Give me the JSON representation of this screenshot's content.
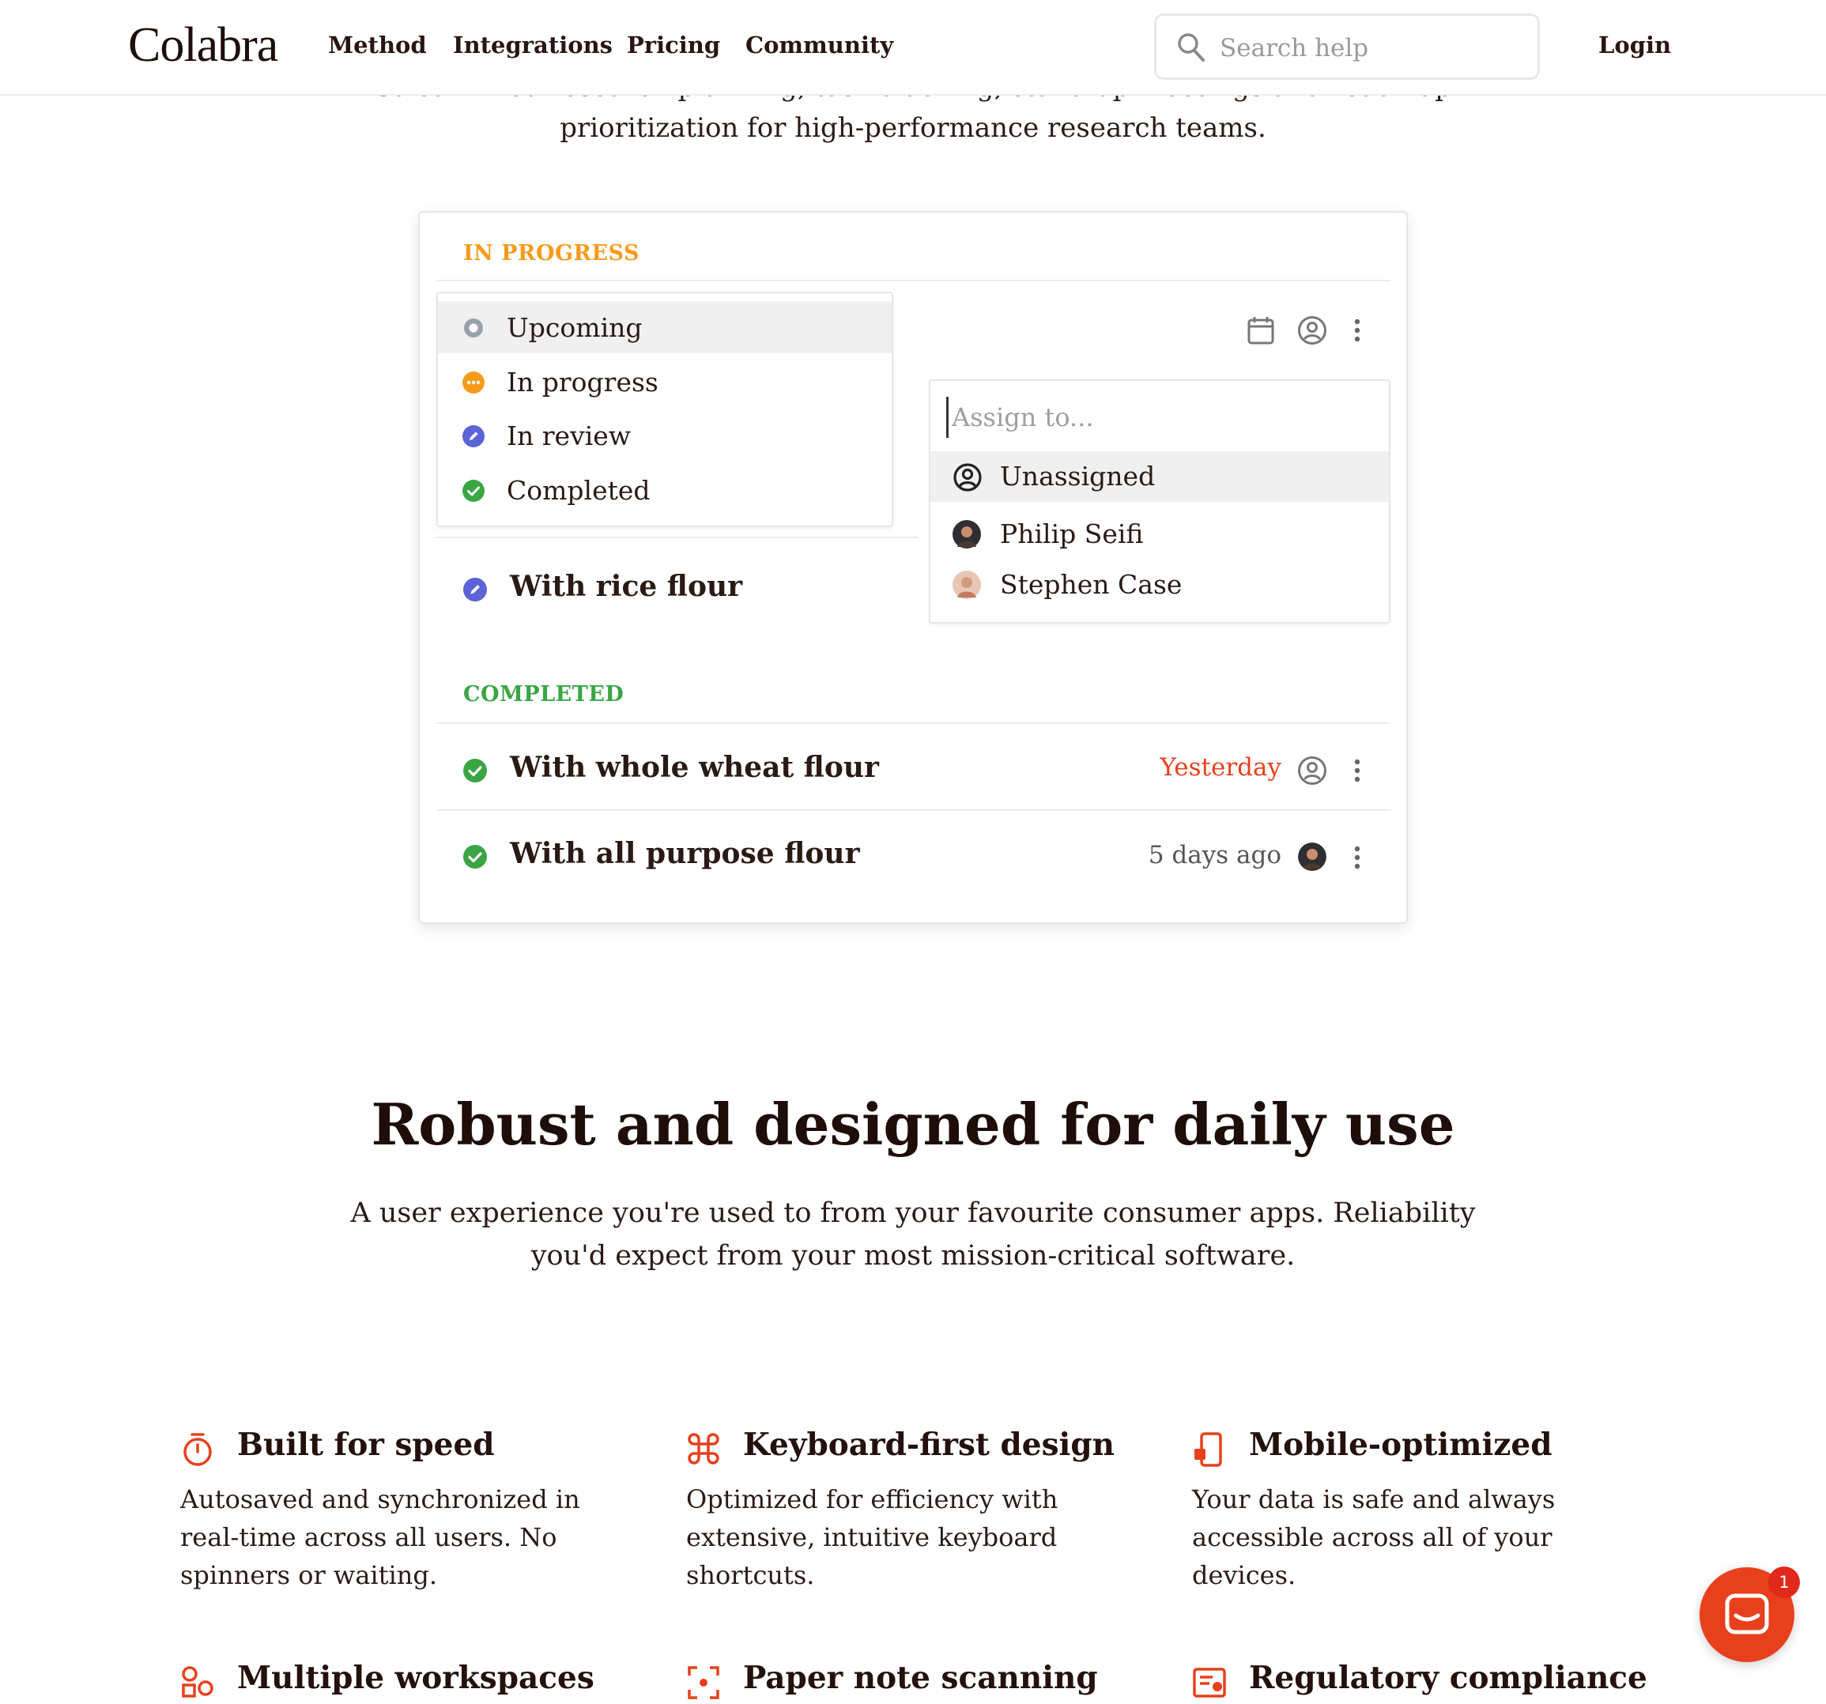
{
  "header": {
    "logo": "Colabra",
    "nav": [
      "Method",
      "Integrations",
      "Pricing",
      "Community"
    ],
    "search_placeholder": "Search help",
    "login": "Login"
  },
  "hero": {
    "line1_cut": "Streamlined research planning, task tracking, stand-up meetings and roadmap",
    "line2": "prioritization for high-performance research teams."
  },
  "board": {
    "in_progress_label": "IN PROGRESS",
    "completed_label": "COMPLETED",
    "status_menu": [
      "Upcoming",
      "In progress",
      "In review",
      "Completed"
    ],
    "assign_placeholder": "Assign to...",
    "assignees": [
      "Unassigned",
      "Philip Seifi",
      "Stephen Case"
    ],
    "tasks_in_progress": [
      {
        "title": "With rice flour",
        "status": "In review"
      }
    ],
    "tasks_completed": [
      {
        "title": "With whole wheat flour",
        "due": "Yesterday",
        "due_color": "#e8401c"
      },
      {
        "title": "With all purpose flour",
        "due": "5 days ago",
        "due_color": "#555555"
      }
    ],
    "colors": {
      "in_progress": "#f59b1c",
      "completed": "#3aa544",
      "review": "#5b63d6",
      "upcoming": "#9aa3ad"
    }
  },
  "features": {
    "title": "Robust and designed for daily use",
    "subtitle_line1": "A user experience you're used to from your favourite consumer apps. Reliability",
    "subtitle_line2": "you'd expect from your most mission-critical software.",
    "items": [
      {
        "icon": "stopwatch-icon",
        "title": "Built for speed",
        "desc": "Autosaved and synchronized in real-time across all users. No spinners or waiting."
      },
      {
        "icon": "command-key-icon",
        "title": "Keyboard-first design",
        "desc": "Optimized for efficiency with extensive, intuitive keyboard shortcuts."
      },
      {
        "icon": "mobile-icon",
        "title": "Mobile-optimized",
        "desc": "Your data is safe and always accessible across all of your devices."
      },
      {
        "icon": "workspaces-icon",
        "title": "Multiple workspaces",
        "desc": ""
      },
      {
        "icon": "scan-icon",
        "title": "Paper note scanning",
        "desc": ""
      },
      {
        "icon": "compliance-icon",
        "title": "Regulatory compliance",
        "desc": ""
      }
    ],
    "accent": "#e8401c"
  },
  "chat": {
    "badge_count": "1",
    "color": "#e8401c"
  }
}
